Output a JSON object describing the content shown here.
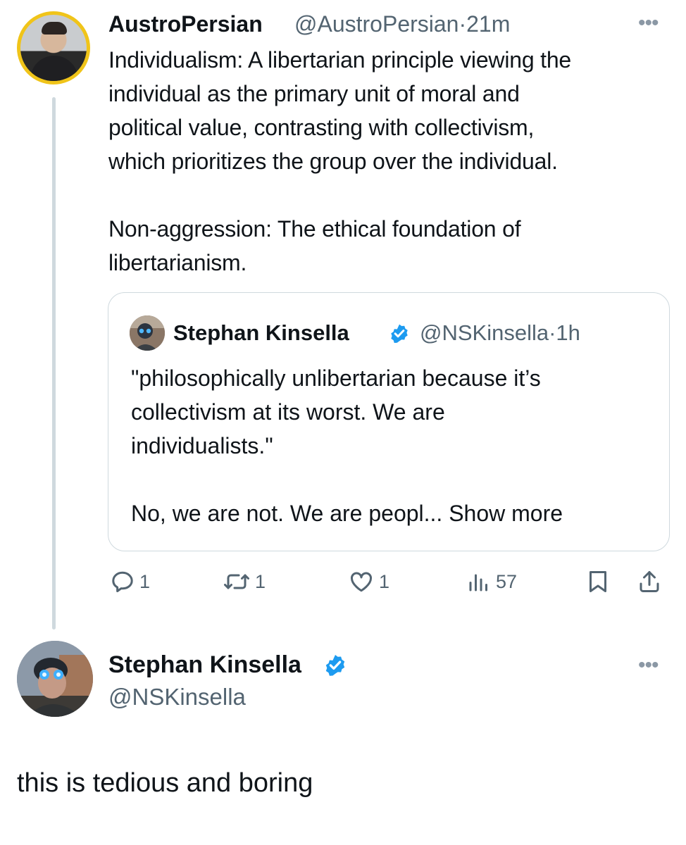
{
  "tweet": {
    "author_name": "AustroPersian",
    "author_handle": "@AustroPersian",
    "separator": "·",
    "time": "21m",
    "more_label": "•••",
    "text": "Individualism: A libertarian principle viewing the\nindividual as the primary unit of moral and\npolitical value, contrasting with collectivism,\nwhich prioritizes the group over the individual.\n\nNon-aggression: The ethical foundation of\nlibertarianism."
  },
  "quote": {
    "author_name": "Stephan Kinsella",
    "author_handle": "@NSKinsella",
    "separator": "·",
    "time": "1h",
    "text": "\"philosophically unlibertarian because it’s\ncollectivism at its worst. We are\nindividualists.\"\n\nNo, we are not. We are peopl... ",
    "show_more": "Show more"
  },
  "actions": {
    "reply_count": "1",
    "retweet_count": "1",
    "like_count": "1",
    "view_count": "57"
  },
  "reply": {
    "author_name": "Stephan Kinsella",
    "author_handle": "@NSKinsella",
    "more_label": "•••",
    "text": "this is tedious and boring"
  },
  "colors": {
    "text_primary": "#0f1419",
    "text_secondary": "#536471",
    "verified_blue": "#1d9bf0",
    "border": "#cfd9de",
    "avatar_ring": "#f0c419"
  },
  "icons": [
    "reply-icon",
    "retweet-icon",
    "like-icon",
    "views-icon",
    "bookmark-icon",
    "share-icon",
    "verified-badge-icon",
    "more-options-icon"
  ]
}
